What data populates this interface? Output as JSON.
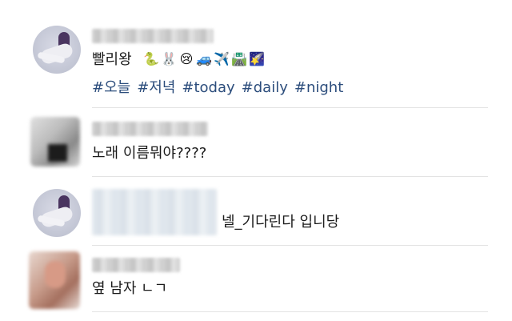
{
  "comments": [
    {
      "text": "빨리왕",
      "emojis": [
        "🐍",
        "🐰",
        "😢",
        "🚙",
        "✈️",
        "🛣️",
        "🌠"
      ],
      "hashtags": [
        "#오늘",
        "#저녁",
        "#today",
        "#daily",
        "#night"
      ]
    },
    {
      "text": "노래 이름뭐야????"
    },
    {
      "text": "넬_기다린다 입니당"
    },
    {
      "text": "옆 남자 ㄴㄱ"
    }
  ],
  "colors": {
    "hashtag": "#2c4d7c",
    "text": "#1b1b1b",
    "divider": "#e3e3e3"
  }
}
